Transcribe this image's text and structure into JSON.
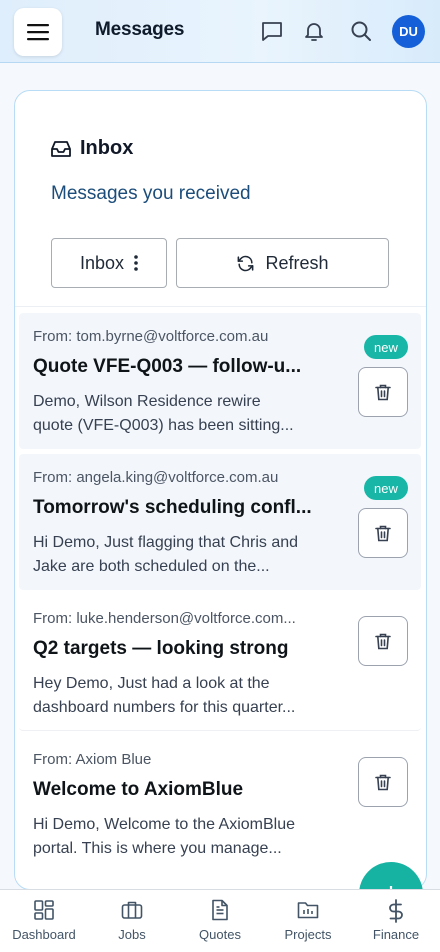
{
  "header": {
    "title": "Messages",
    "menu_icon": "hamburger-icon",
    "icons": [
      "chat-icon",
      "bell-icon",
      "search-icon"
    ],
    "avatar_initials": "DU",
    "avatar_color": "#1560d8"
  },
  "inbox": {
    "title": "Inbox",
    "icon": "inbox-icon",
    "subtitle": "Messages you received",
    "folder_button_label": "Inbox",
    "refresh_label": "Refresh"
  },
  "messages": [
    {
      "from": "From: tom.byrne@voltforce.com.au",
      "subject": "Quote VFE-Q003 — follow-u...",
      "preview_line1": "Demo, Wilson Residence rewire",
      "preview_line2": "quote (VFE-Q003) has been sitting...",
      "badge": "new",
      "unread": true
    },
    {
      "from": "From: angela.king@voltforce.com.au",
      "subject": "Tomorrow's scheduling confl...",
      "preview_line1": "Hi Demo, Just flagging that Chris and",
      "preview_line2": "Jake are both scheduled on the...",
      "badge": "new",
      "unread": true
    },
    {
      "from": "From: luke.henderson@voltforce.com...",
      "subject": "Q2 targets — looking strong",
      "preview_line1": "Hey Demo, Just had a look at the",
      "preview_line2": "dashboard numbers for this quarter...",
      "badge": "",
      "unread": false
    },
    {
      "from": "From: Axiom Blue",
      "subject": "Welcome to AxiomBlue",
      "preview_line1": "Hi Demo, Welcome to the AxiomBlue",
      "preview_line2": "portal. This is where you manage...",
      "badge": "",
      "unread": false
    }
  ],
  "fab": {
    "label": "+"
  },
  "bottom_nav": [
    {
      "label": "Dashboard",
      "icon": "dashboard-icon"
    },
    {
      "label": "Jobs",
      "icon": "briefcase-icon"
    },
    {
      "label": "Quotes",
      "icon": "document-icon"
    },
    {
      "label": "Projects",
      "icon": "folder-icon"
    },
    {
      "label": "Finance",
      "icon": "dollar-icon"
    }
  ],
  "colors": {
    "accent_teal": "#17b6a6",
    "brand_blue": "#1560d8",
    "subtitle_blue": "#1c4d7a"
  }
}
